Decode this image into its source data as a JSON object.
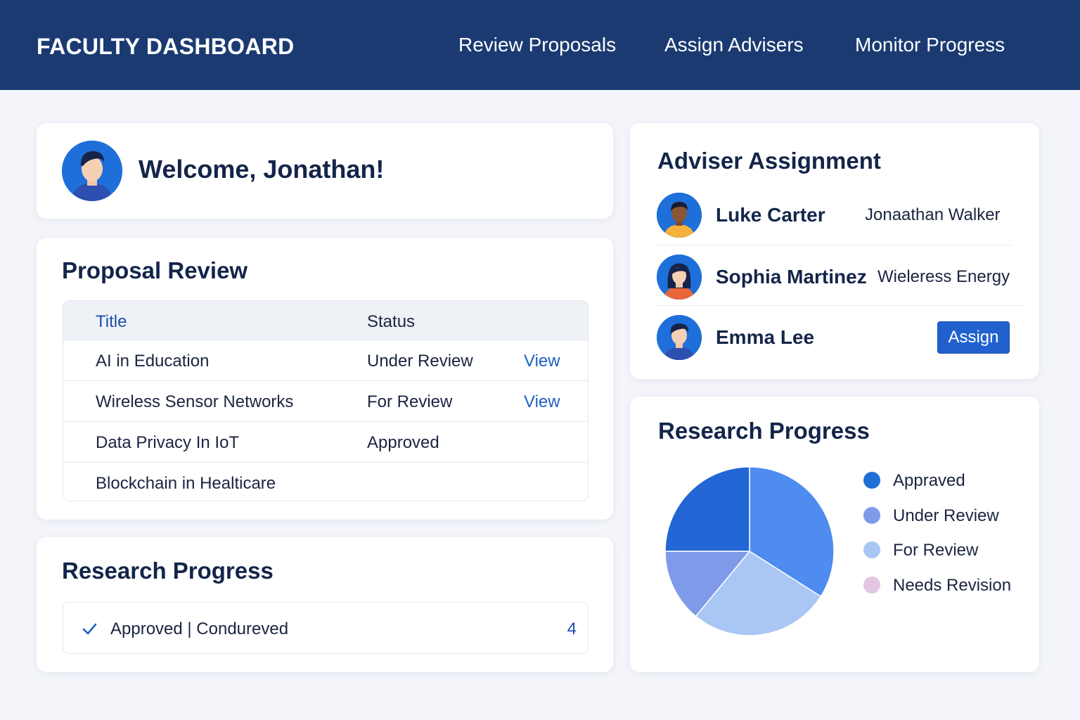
{
  "header": {
    "title": "FACULTY DASHBOARD",
    "nav": [
      "Review Proposals",
      "Assign Advisers",
      "Monitor Progress"
    ]
  },
  "welcome": {
    "text": "Welcome, Jonathan!",
    "avatar_icon": "user-avatar-icon"
  },
  "proposal_review": {
    "title": "Proposal Review",
    "columns": [
      "Title",
      "Status"
    ],
    "rows": [
      {
        "title": "AI in Education",
        "status": "Under Review",
        "action": "View"
      },
      {
        "title": "Wireless Sensor Networks",
        "status": "For Review",
        "action": "View"
      },
      {
        "title": "Data Privacy In IoT",
        "status": "Approved",
        "action": ""
      },
      {
        "title": "Blockchain in Healticare",
        "status": "",
        "action": ""
      }
    ]
  },
  "research_progress_summary": {
    "title": "Research Progress",
    "text": "Approved | Condureved",
    "count": "4",
    "icon": "checkmark-icon"
  },
  "adviser_assignment": {
    "title": "Adviser Assignment",
    "advisers": [
      {
        "name": "Luke Carter",
        "topic": "Jonaathan Walker"
      },
      {
        "name": "Sophia Martinez",
        "topic": "Wieleress Energy"
      },
      {
        "name": "Emma Lee",
        "topic": ""
      }
    ],
    "assign_label": "Assign"
  },
  "research_progress_chart": {
    "title": "Research Progress",
    "legend": [
      {
        "label": "Appraved",
        "color": "#1f6fd6"
      },
      {
        "label": "Under Review",
        "color": "#7f9ae8"
      },
      {
        "label": "For Review",
        "color": "#aac6f4"
      },
      {
        "label": "Needs Revision",
        "color": "#e2c6e2"
      }
    ]
  },
  "chart_data": {
    "type": "pie",
    "slices": [
      {
        "color": "#4e8cf0",
        "value": 34
      },
      {
        "color": "#aac6f4",
        "value": 27
      },
      {
        "color": "#7f9ae8",
        "value": 14
      },
      {
        "color": "#2366d6",
        "value": 25
      }
    ],
    "start_angle_deg": 0
  }
}
